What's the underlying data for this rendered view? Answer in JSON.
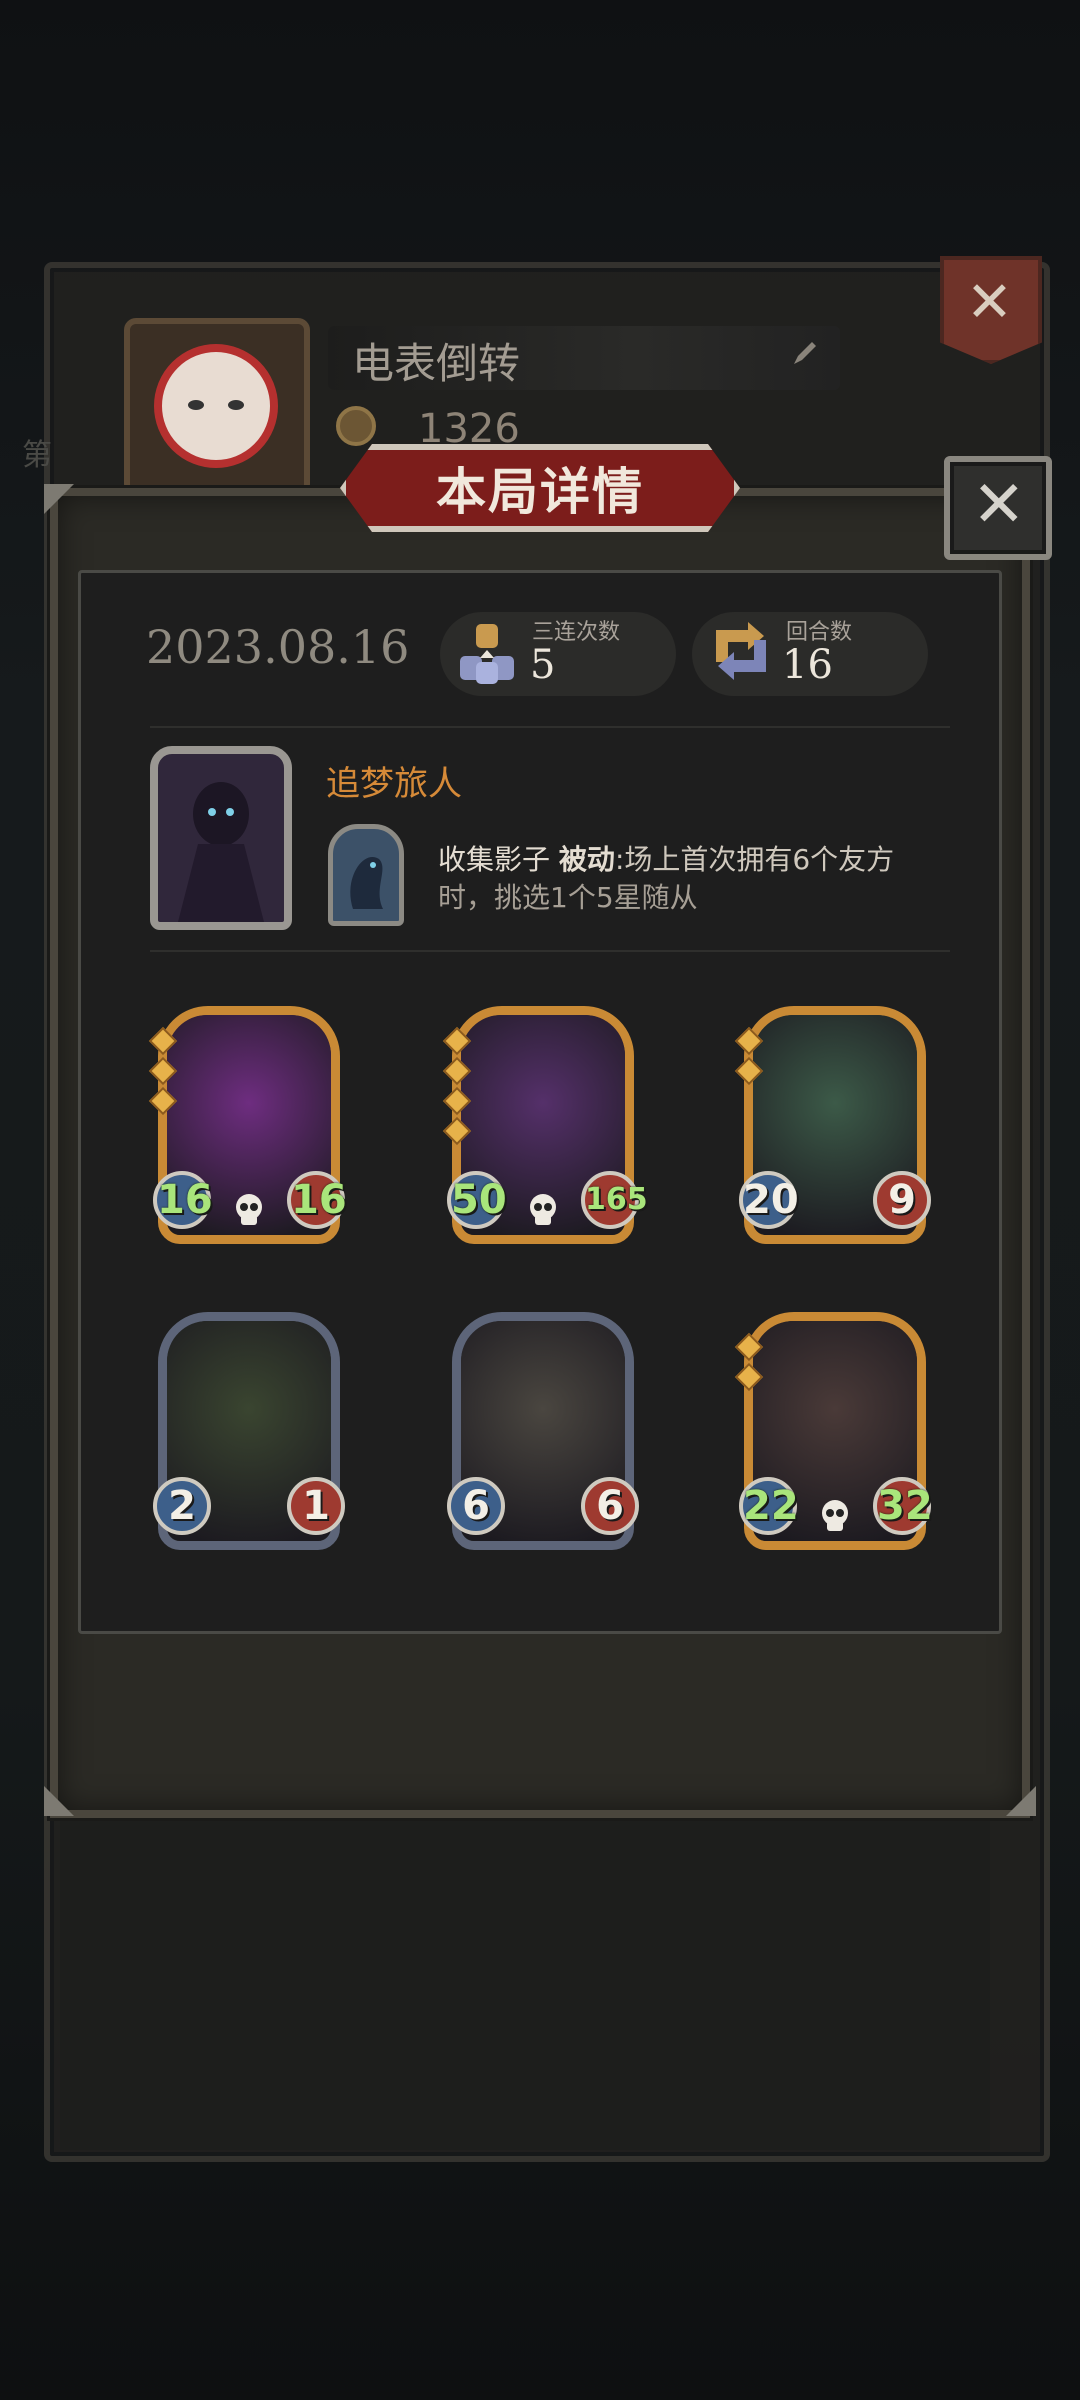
{
  "profile": {
    "player_name": "电表倒转",
    "coins": "1326",
    "side_char": "第"
  },
  "modal": {
    "title": "本局详情",
    "date": "2023.08.16",
    "triples_label": "三连次数",
    "triples_value": "5",
    "rounds_label": "回合数",
    "rounds_value": "16"
  },
  "hero": {
    "name": "追梦旅人",
    "skill_name": "收集影子",
    "skill_tag": "被动",
    "skill_desc_1": ":场上首次拥有6个友方",
    "skill_desc_2": "时，挑选1个5星随从"
  },
  "units": [
    {
      "atk": "16",
      "hp": "16",
      "stars": 3,
      "frame": "gold",
      "art": "#6e2d80",
      "golden": true
    },
    {
      "atk": "50",
      "hp": "165",
      "stars": 4,
      "frame": "gold",
      "art": "#55306a",
      "golden": true
    },
    {
      "atk": "20",
      "hp": "9",
      "stars": 2,
      "frame": "gold",
      "art": "#3c5a48",
      "golden": false
    },
    {
      "atk": "2",
      "hp": "1",
      "stars": 0,
      "frame": "steel",
      "art": "#3a4530",
      "golden": false
    },
    {
      "atk": "6",
      "hp": "6",
      "stars": 0,
      "frame": "steel",
      "art": "#4a4640",
      "golden": false
    },
    {
      "atk": "22",
      "hp": "32",
      "stars": 2,
      "frame": "gold",
      "art": "#4a3a38",
      "golden": true
    }
  ],
  "colors": {
    "accent_title": "#7c1d1b",
    "hero_name": "#d68a38",
    "stat_green": "#a9e57b"
  }
}
